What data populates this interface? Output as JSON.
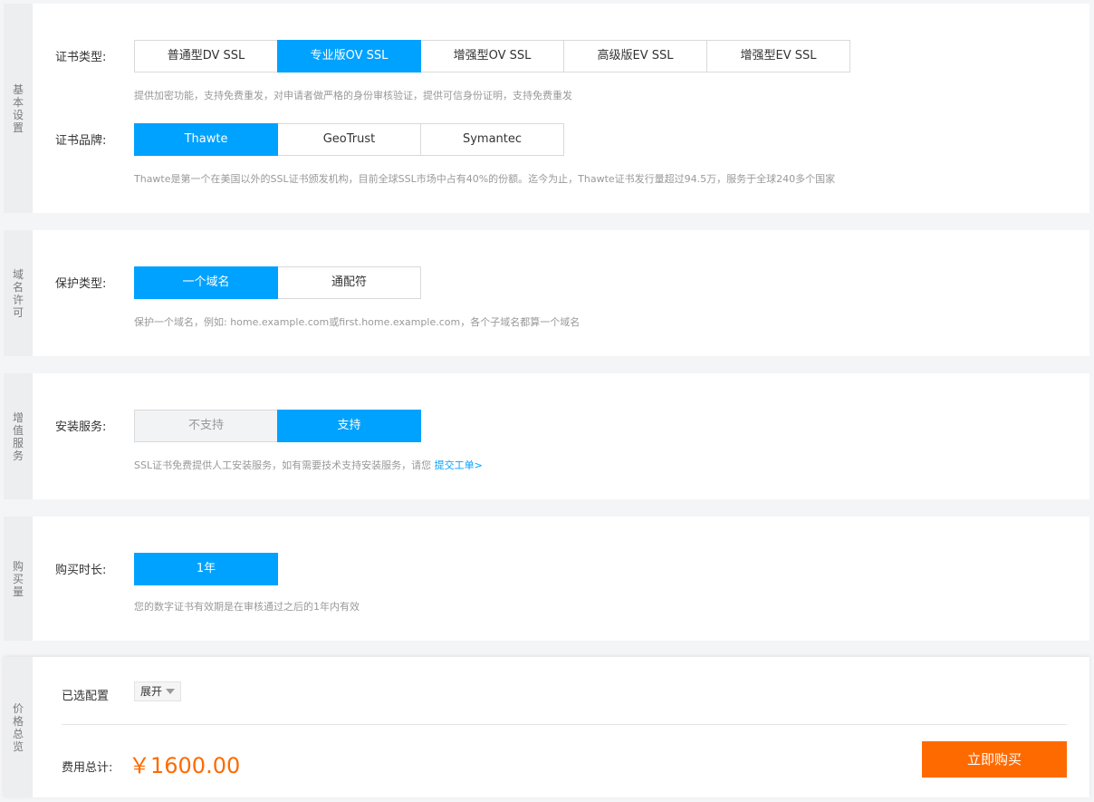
{
  "basic": {
    "section_label": "基本设置",
    "cert_type_label": "证书类型:",
    "cert_types": [
      "普通型DV SSL",
      "专业版OV SSL",
      "增强型OV SSL",
      "高级版EV SSL",
      "增强型EV SSL"
    ],
    "cert_type_desc": "提供加密功能，支持免费重发，对申请者做严格的身份审核验证，提供可信身份证明，支持免费重发",
    "brand_label": "证书品牌:",
    "brands": [
      "Thawte",
      "GeoTrust",
      "Symantec"
    ],
    "brand_desc": "Thawte是第一个在美国以外的SSL证书颁发机构，目前全球SSL市场中占有40%的份额。迄今为止，Thawte证书发行量超过94.5万，服务于全球240多个国家"
  },
  "domain": {
    "section_label": "域名许可",
    "protect_label": "保护类型:",
    "protect_types": [
      "一个域名",
      "通配符"
    ],
    "protect_desc": "保护一个域名，例如: home.example.com或first.home.example.com，各个子域名都算一个域名"
  },
  "value_added": {
    "section_label": "增值服务",
    "install_label": "安装服务:",
    "install_options": [
      "不支持",
      "支持"
    ],
    "install_desc": "SSL证书免费提供人工安装服务，如有需要技术支持安装服务，请您",
    "install_link": "提交工单>"
  },
  "purchase": {
    "section_label": "购买量",
    "duration_label": "购买时长:",
    "durations": [
      "1年"
    ],
    "duration_desc": "您的数字证书有效期是在审核通过之后的1年内有效"
  },
  "summary": {
    "section_label": "价格总览",
    "selected_label": "已选配置",
    "expand_label": "展开",
    "total_label": "费用总计:",
    "price": "￥1600.00",
    "buy_label": "立即购买"
  },
  "colors": {
    "accent": "#00a2ff",
    "price": "#ff6a00"
  }
}
